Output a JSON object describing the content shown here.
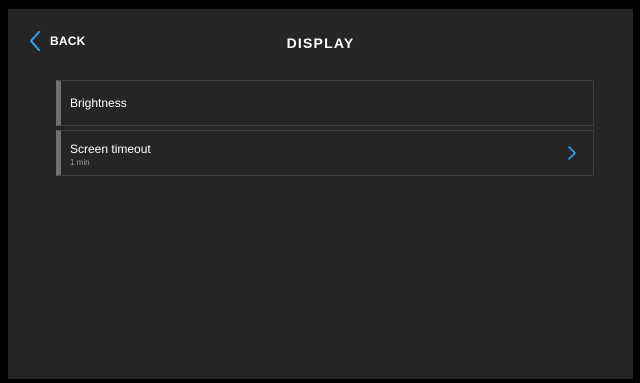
{
  "header": {
    "back_label": "BACK",
    "title": "DISPLAY",
    "back_icon": "chevron-left-icon"
  },
  "settings": {
    "items": [
      {
        "label": "Brightness"
      },
      {
        "label": "Screen timeout",
        "value": "1 min",
        "icon": "chevron-right-icon"
      }
    ]
  },
  "colors": {
    "accent": "#2ea3f2",
    "background": "#252525",
    "item_border": "#3c3c3c",
    "item_marker": "#6f6f6f"
  }
}
